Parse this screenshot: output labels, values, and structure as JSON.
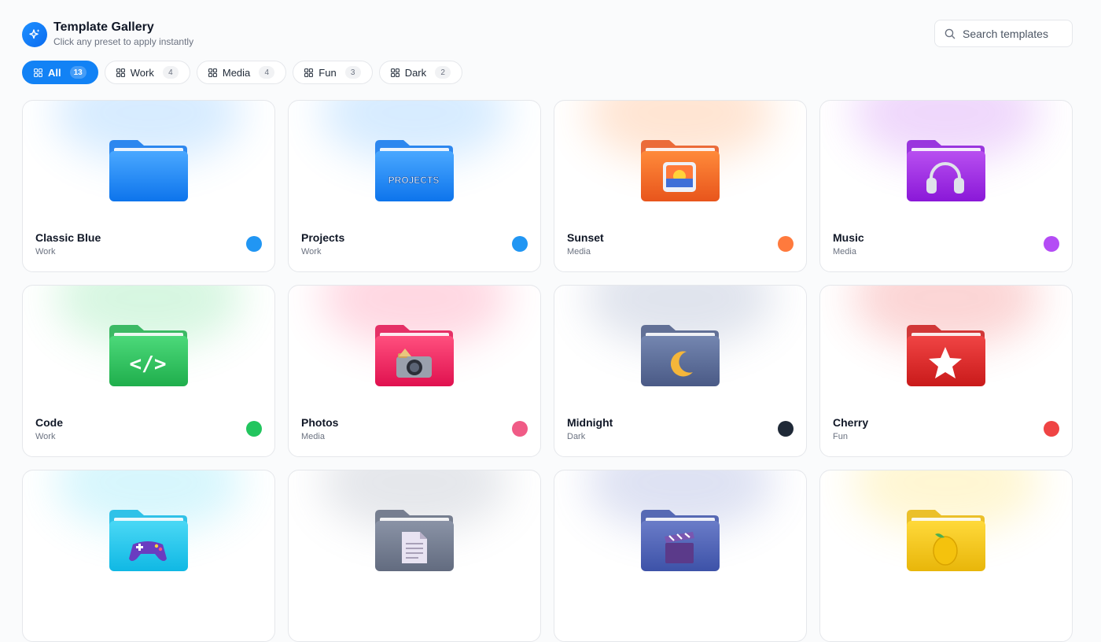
{
  "header": {
    "title": "Template Gallery",
    "subtitle": "Click any preset to apply instantly"
  },
  "search": {
    "placeholder": "Search templates"
  },
  "filters": [
    {
      "label": "All",
      "count": "13",
      "active": true
    },
    {
      "label": "Work",
      "count": "4",
      "active": false
    },
    {
      "label": "Media",
      "count": "4",
      "active": false
    },
    {
      "label": "Fun",
      "count": "3",
      "active": false
    },
    {
      "label": "Dark",
      "count": "2",
      "active": false
    }
  ],
  "templates": [
    {
      "name": "Classic Blue",
      "category": "Work",
      "swatch": "#2196f3",
      "top": "#4aa8ff",
      "bottom": "#0d74ec",
      "emblem": "none",
      "emblem_text": ""
    },
    {
      "name": "Projects",
      "category": "Work",
      "swatch": "#2196f3",
      "top": "#4aa8ff",
      "bottom": "#0d74ec",
      "emblem": "text",
      "emblem_text": "PROJECTS"
    },
    {
      "name": "Sunset",
      "category": "Media",
      "swatch": "#ff7a3d",
      "top": "#ff8a3a",
      "bottom": "#e8551c",
      "emblem": "sunset",
      "emblem_text": ""
    },
    {
      "name": "Music",
      "category": "Media",
      "swatch": "#b44cf5",
      "top": "#b84ff0",
      "bottom": "#8a18d8",
      "emblem": "headphones",
      "emblem_text": ""
    },
    {
      "name": "Code",
      "category": "Work",
      "swatch": "#22c55e",
      "top": "#4cd97a",
      "bottom": "#1fae4c",
      "emblem": "text",
      "emblem_text": "</>"
    },
    {
      "name": "Photos",
      "category": "Media",
      "swatch": "#f05b86",
      "top": "#ff4f7e",
      "bottom": "#e0114f",
      "emblem": "camera",
      "emblem_text": ""
    },
    {
      "name": "Midnight",
      "category": "Dark",
      "swatch": "#1f2937",
      "top": "#7486b0",
      "bottom": "#4a5a86",
      "emblem": "moon",
      "emblem_text": ""
    },
    {
      "name": "Cherry",
      "category": "Fun",
      "swatch": "#ef4444",
      "top": "#f04444",
      "bottom": "#c91a1a",
      "emblem": "star",
      "emblem_text": ""
    },
    {
      "name": "",
      "category": "",
      "swatch": "",
      "top": "#4ad8f5",
      "bottom": "#10b8e4",
      "emblem": "gamepad",
      "emblem_text": ""
    },
    {
      "name": "",
      "category": "",
      "swatch": "",
      "top": "#8a93a6",
      "bottom": "#626b7f",
      "emblem": "document",
      "emblem_text": ""
    },
    {
      "name": "",
      "category": "",
      "swatch": "",
      "top": "#6a7cc8",
      "bottom": "#3d52a8",
      "emblem": "clapper",
      "emblem_text": ""
    },
    {
      "name": "",
      "category": "",
      "swatch": "",
      "top": "#ffd93a",
      "bottom": "#e8b60a",
      "emblem": "lemon",
      "emblem_text": ""
    }
  ]
}
